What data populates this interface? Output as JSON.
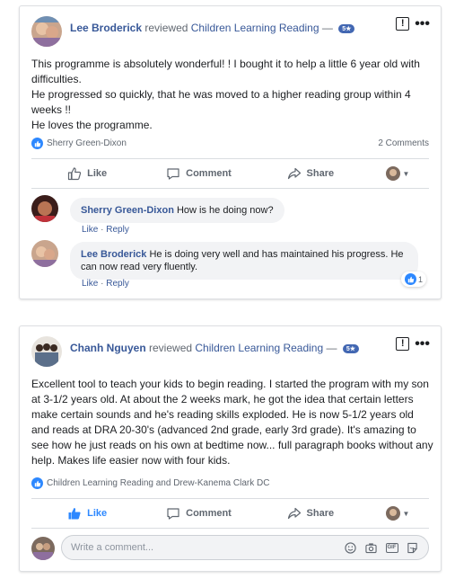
{
  "colors": {
    "link": "#385898",
    "accent": "#2d88ff",
    "badge": "#4267b2",
    "muted": "#606770",
    "bubble": "#f2f3f5"
  },
  "posts": [
    {
      "author": "Lee Broderick",
      "verb": "reviewed",
      "page": "Children Learning Reading",
      "dash": "—",
      "rating_badge": "5★",
      "report_icon": "!",
      "more_icon": "•••",
      "paragraphs": [
        "This programme is absolutely wonderful! ! I bought it to help a little 6 year old with difficulties.",
        "He progressed so quickly, that he was moved to a higher reading group within 4 weeks !!",
        "He loves the programme."
      ],
      "likers": "Sherry Green-Dixon",
      "comments_count": "2 Comments",
      "actions": {
        "like": "Like",
        "comment": "Comment",
        "share": "Share"
      },
      "comments": [
        {
          "author": "Sherry Green-Dixon",
          "text": "How is he doing now?",
          "like": "Like",
          "sep": "·",
          "reply": "Reply"
        },
        {
          "author": "Lee Broderick",
          "text": "He is doing very well and has maintained his progress. He can now read very fluently.",
          "like": "Like",
          "sep": "·",
          "reply": "Reply",
          "reactions": "1"
        }
      ]
    },
    {
      "author": "Chanh Nguyen",
      "verb": "reviewed",
      "page": "Children Learning Reading",
      "dash": "—",
      "rating_badge": "5★",
      "report_icon": "!",
      "more_icon": "•••",
      "paragraphs": [
        "Excellent tool to teach your kids to begin reading. I started the program with my son at 3-1/2 years old. At about the 2 weeks mark, he got the idea that certain letters make certain sounds and he's reading skills exploded. He is now 5-1/2 years old and reads at DRA 20-30's (advanced 2nd grade, early 3rd grade). It's amazing to see how he just reads on his own at bedtime now... full paragraph books without any help. Makes life easier now with four kids."
      ],
      "likers": "Children Learning Reading and Drew-Kanema Clark DC",
      "actions": {
        "like": "Like",
        "comment": "Comment",
        "share": "Share"
      },
      "write_placeholder": "Write a comment...",
      "write_icons": [
        "emoji-icon",
        "camera-icon",
        "gif-icon",
        "sticker-icon"
      ],
      "gif_label": "GIF"
    }
  ]
}
